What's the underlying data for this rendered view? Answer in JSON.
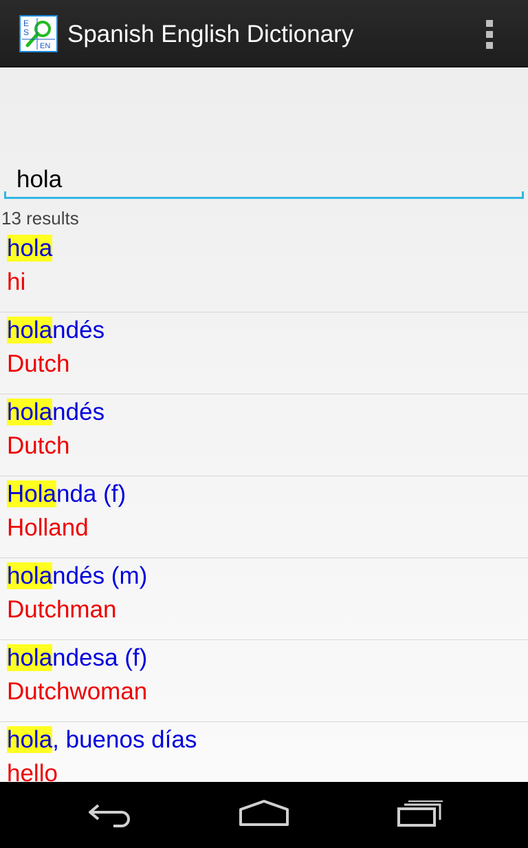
{
  "app": {
    "title": "Spanish English Dictionary",
    "icon_name": "dictionary-app-icon",
    "icon_letters": [
      "E",
      "S",
      "EN"
    ]
  },
  "search": {
    "value": "hola",
    "placeholder": ""
  },
  "result_count": "13 results",
  "results": [
    {
      "highlight": "hola",
      "rest": "",
      "translation": "hi"
    },
    {
      "highlight": "hola",
      "rest": "ndés",
      "translation": "Dutch"
    },
    {
      "highlight": "hola",
      "rest": "ndés",
      "translation": "Dutch"
    },
    {
      "highlight": "Hola",
      "rest": "nda (f)",
      "translation": "Holland"
    },
    {
      "highlight": "hola",
      "rest": "ndés (m)",
      "translation": "Dutchman"
    },
    {
      "highlight": "hola",
      "rest": "ndesa (f)",
      "translation": "Dutchwoman"
    },
    {
      "highlight": "hola",
      "rest": ", buenos días",
      "translation": "hello"
    }
  ],
  "colors": {
    "term": "#0000dd",
    "translation": "#ee0000",
    "highlight": "#ffff22",
    "accent": "#33b5e5"
  },
  "nav": {
    "back_icon": "back-icon",
    "home_icon": "home-icon",
    "recents_icon": "recent-apps-icon"
  }
}
